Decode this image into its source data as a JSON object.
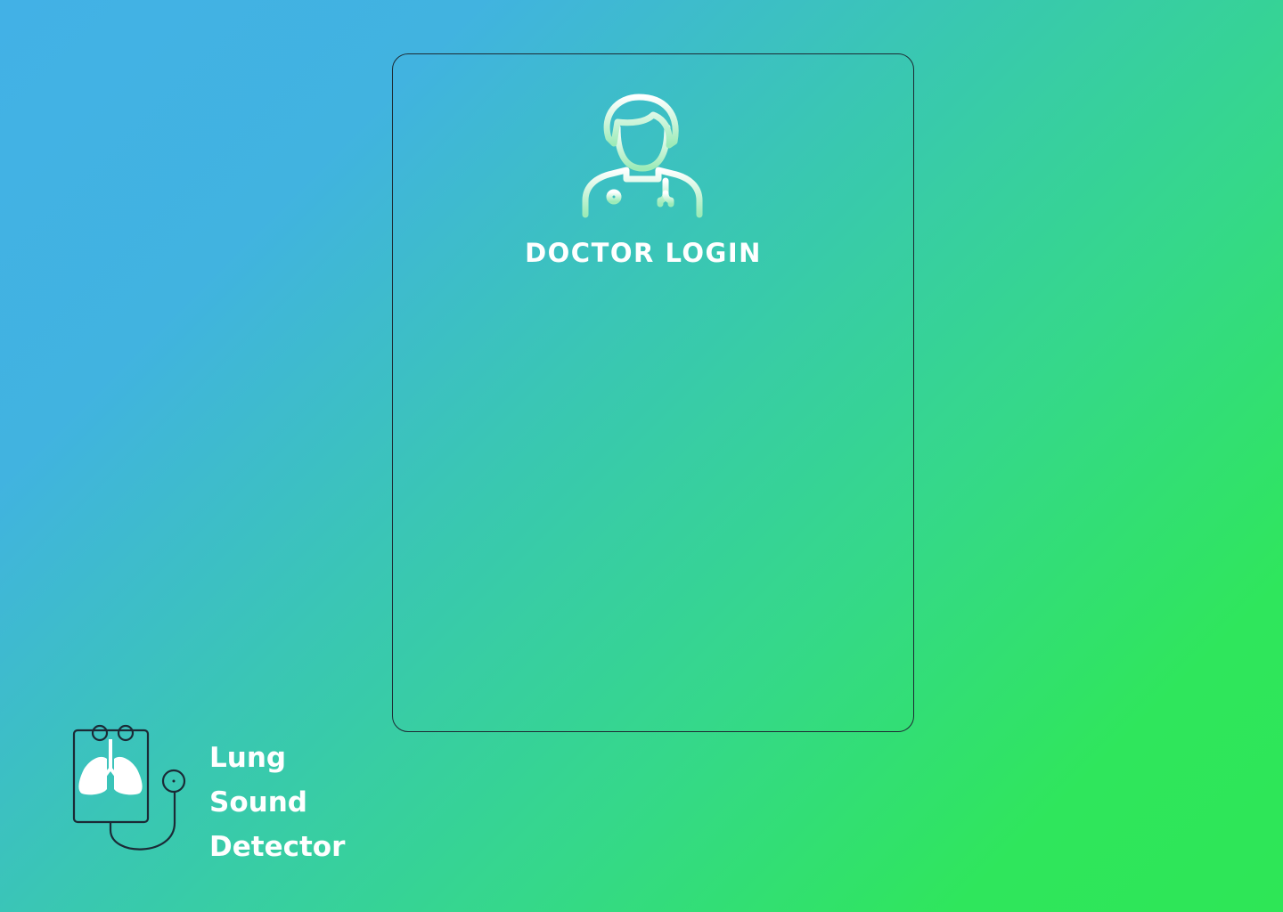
{
  "login": {
    "title": "DOCTOR LOGIN",
    "icon": "doctor-icon"
  },
  "brand": {
    "name_line1": "Lung Sound",
    "name_line2": "Detector",
    "icon": "lung-stethoscope-logo-icon"
  },
  "colors": {
    "gradient_start": "#42b1e6",
    "gradient_end": "#2ee656",
    "card_border": "#1d2a33",
    "text": "#ffffff"
  }
}
